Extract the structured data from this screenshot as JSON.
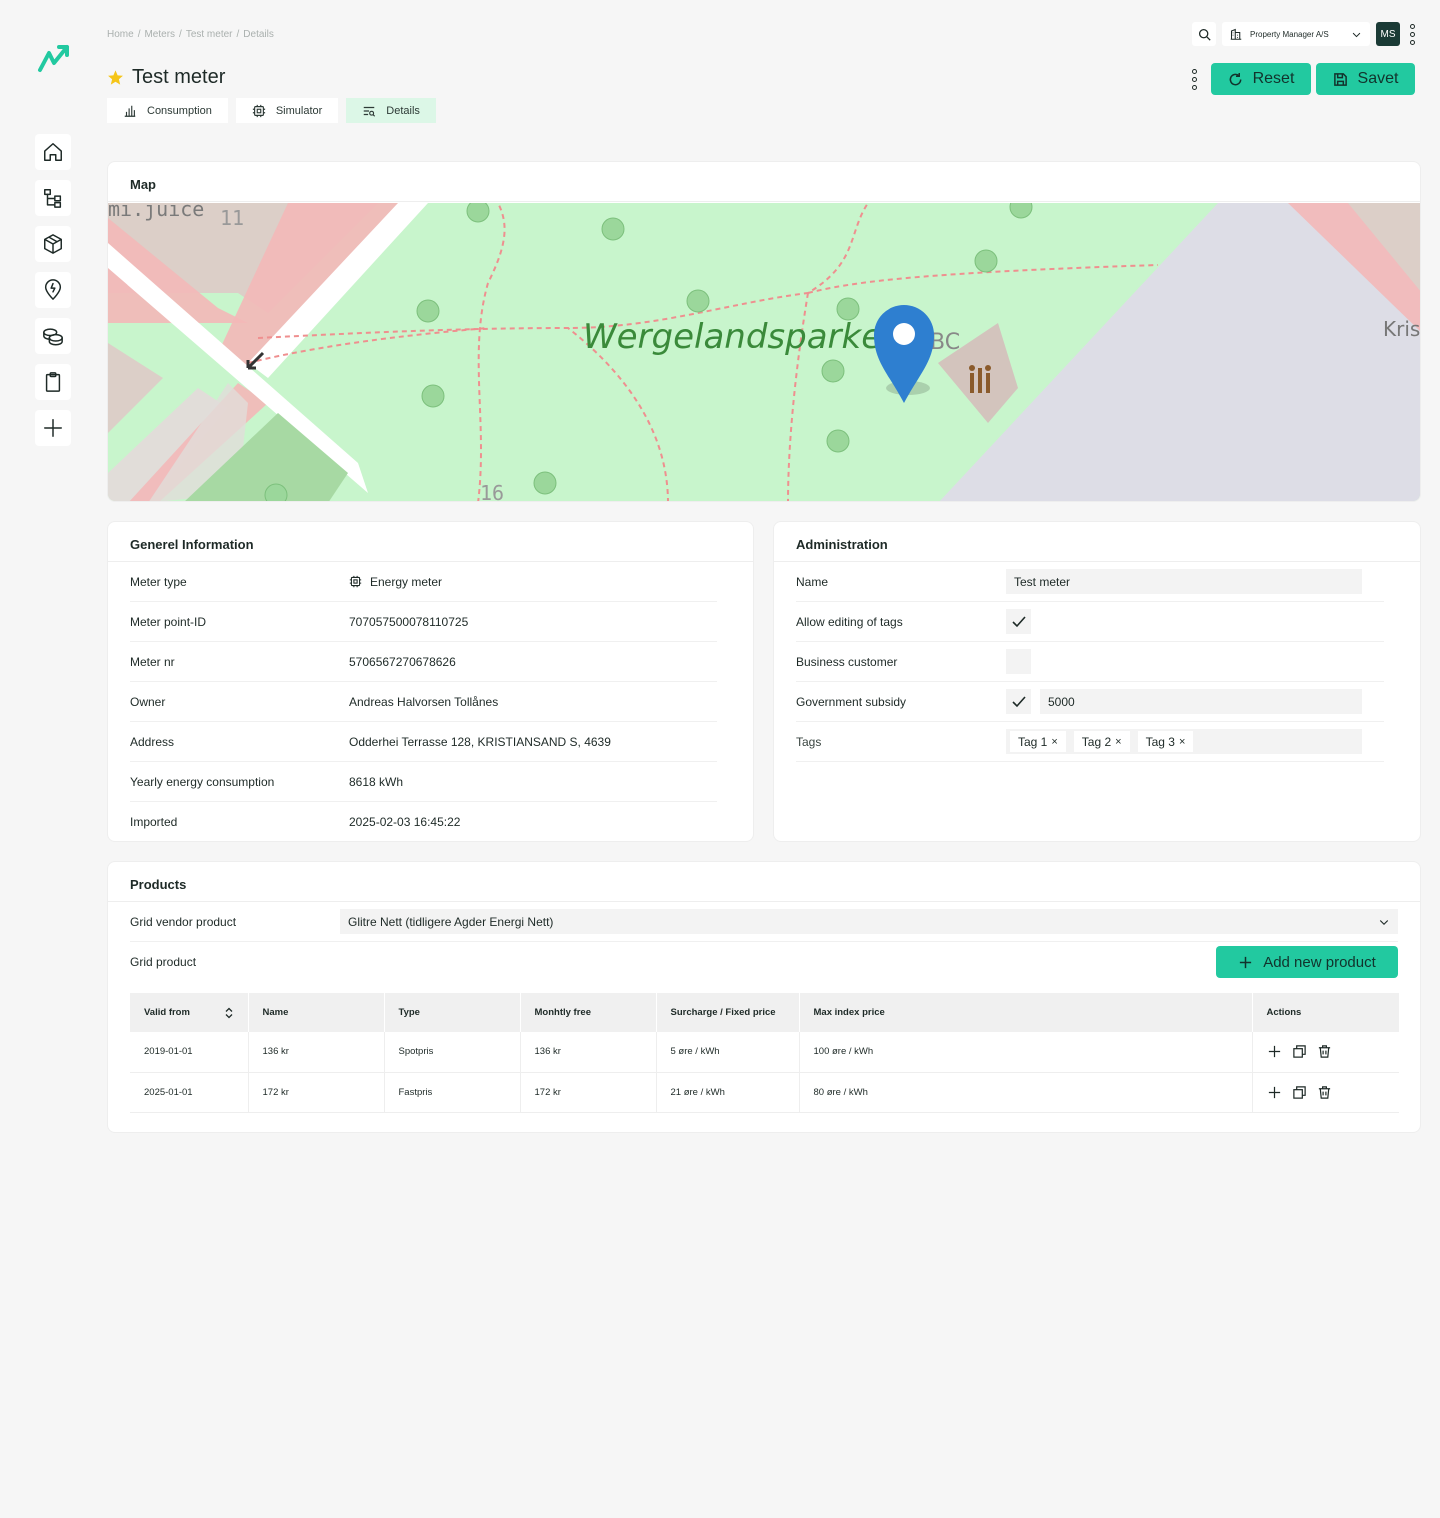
{
  "breadcrumb": [
    "Home",
    "Meters",
    "Test meter",
    "Details"
  ],
  "breadcrumb_sep": "/",
  "page": {
    "title": "Test meter"
  },
  "tabs": [
    {
      "label": "Consumption",
      "icon": "bar-chart-icon"
    },
    {
      "label": "Simulator",
      "icon": "chip-icon"
    },
    {
      "label": "Details",
      "icon": "details-icon",
      "active": true
    }
  ],
  "topbar": {
    "organization": "Property Manager A/S",
    "avatar_initials": "MS"
  },
  "actions": {
    "reset_label": "Reset",
    "save_label": "Savet"
  },
  "colors": {
    "accent": "#22c9a0",
    "active_tab": "#dcf7e7",
    "avatar_bg": "#1a3a35"
  },
  "map": {
    "title": "Map",
    "labels": {
      "park": "Wergelandsparken",
      "street_top": "mi.juice",
      "num_11": "11",
      "num_16": "16",
      "right_edge": "Kris",
      "bc": "BC"
    }
  },
  "general": {
    "title": "Generel Information",
    "rows": [
      {
        "label": "Meter type",
        "value": "Energy meter"
      },
      {
        "label": "Meter point-ID",
        "value": "707057500078110725"
      },
      {
        "label": "Meter nr",
        "value": "5706567270678626"
      },
      {
        "label": "Owner",
        "value": "Andreas Halvorsen Tollånes"
      },
      {
        "label": "Address",
        "value": "Odderhei Terrasse 128, KRISTIANSAND S, 4639"
      },
      {
        "label": "Yearly energy consumption",
        "value": "8618 kWh"
      },
      {
        "label": "Imported",
        "value": "2025-02-03 16:45:22"
      }
    ]
  },
  "admin": {
    "title": "Administration",
    "name_label": "Name",
    "name_value": "Test meter",
    "allow_tags_label": "Allow editing of tags",
    "allow_tags_checked": true,
    "business_label": "Business customer",
    "business_checked": false,
    "subsidy_label": "Government subsidy",
    "subsidy_checked": true,
    "subsidy_value": "5000",
    "tags_label": "Tags",
    "tags": [
      "Tag 1",
      "Tag 2",
      "Tag 3"
    ],
    "tag_remove": "×"
  },
  "products": {
    "title": "Products",
    "vendor_label": "Grid vendor product",
    "vendor_value": "Glitre Nett (tidligere Agder Energi Nett)",
    "grid_label": "Grid product",
    "add_label": "Add new product",
    "columns": [
      "Valid from",
      "Name",
      "Type",
      "Monhtly free",
      "Surcharge / Fixed price",
      "Max index price",
      "Actions"
    ],
    "rows": [
      [
        "2019-01-01",
        "136 kr",
        "Spotpris",
        "136 kr",
        "5 øre / kWh",
        "100 øre / kWh"
      ],
      [
        "2025-01-01",
        "172 kr",
        "Fastpris",
        "172 kr",
        "21 øre / kWh",
        "80 øre / kWh"
      ]
    ]
  }
}
